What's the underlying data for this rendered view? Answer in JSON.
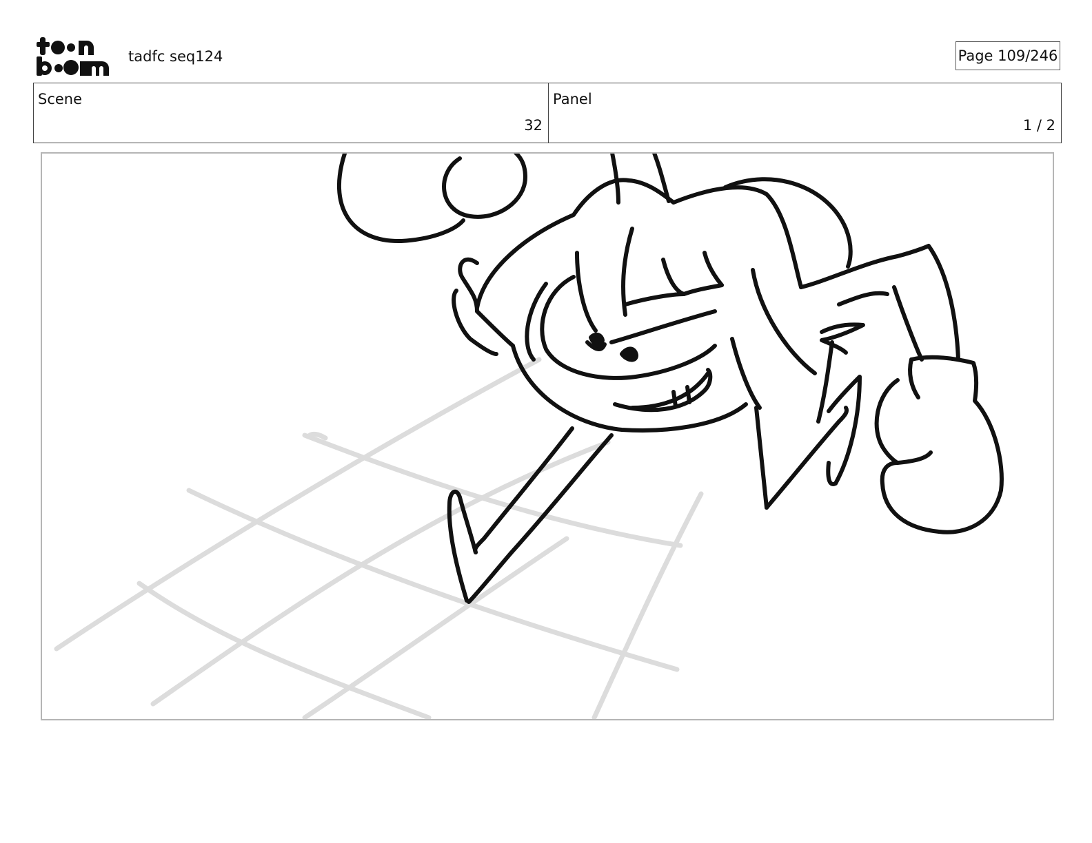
{
  "header": {
    "logo_text": "toonboom",
    "project_title": "tadfc seq124",
    "page_indicator": "Page 109/246"
  },
  "info_bar": {
    "scene_label": "Scene",
    "scene_value": "32",
    "panel_label": "Panel",
    "panel_value": "1 / 2"
  },
  "panel": {
    "image_description": "Storyboard sketch of a cartoon character with a mischievous grin leaning forward over a grid floor, wearing a boxing glove"
  },
  "colors": {
    "line_art": "#111111",
    "floor_grid": "#dcdcdc",
    "frame_border": "#b5b5b5"
  }
}
